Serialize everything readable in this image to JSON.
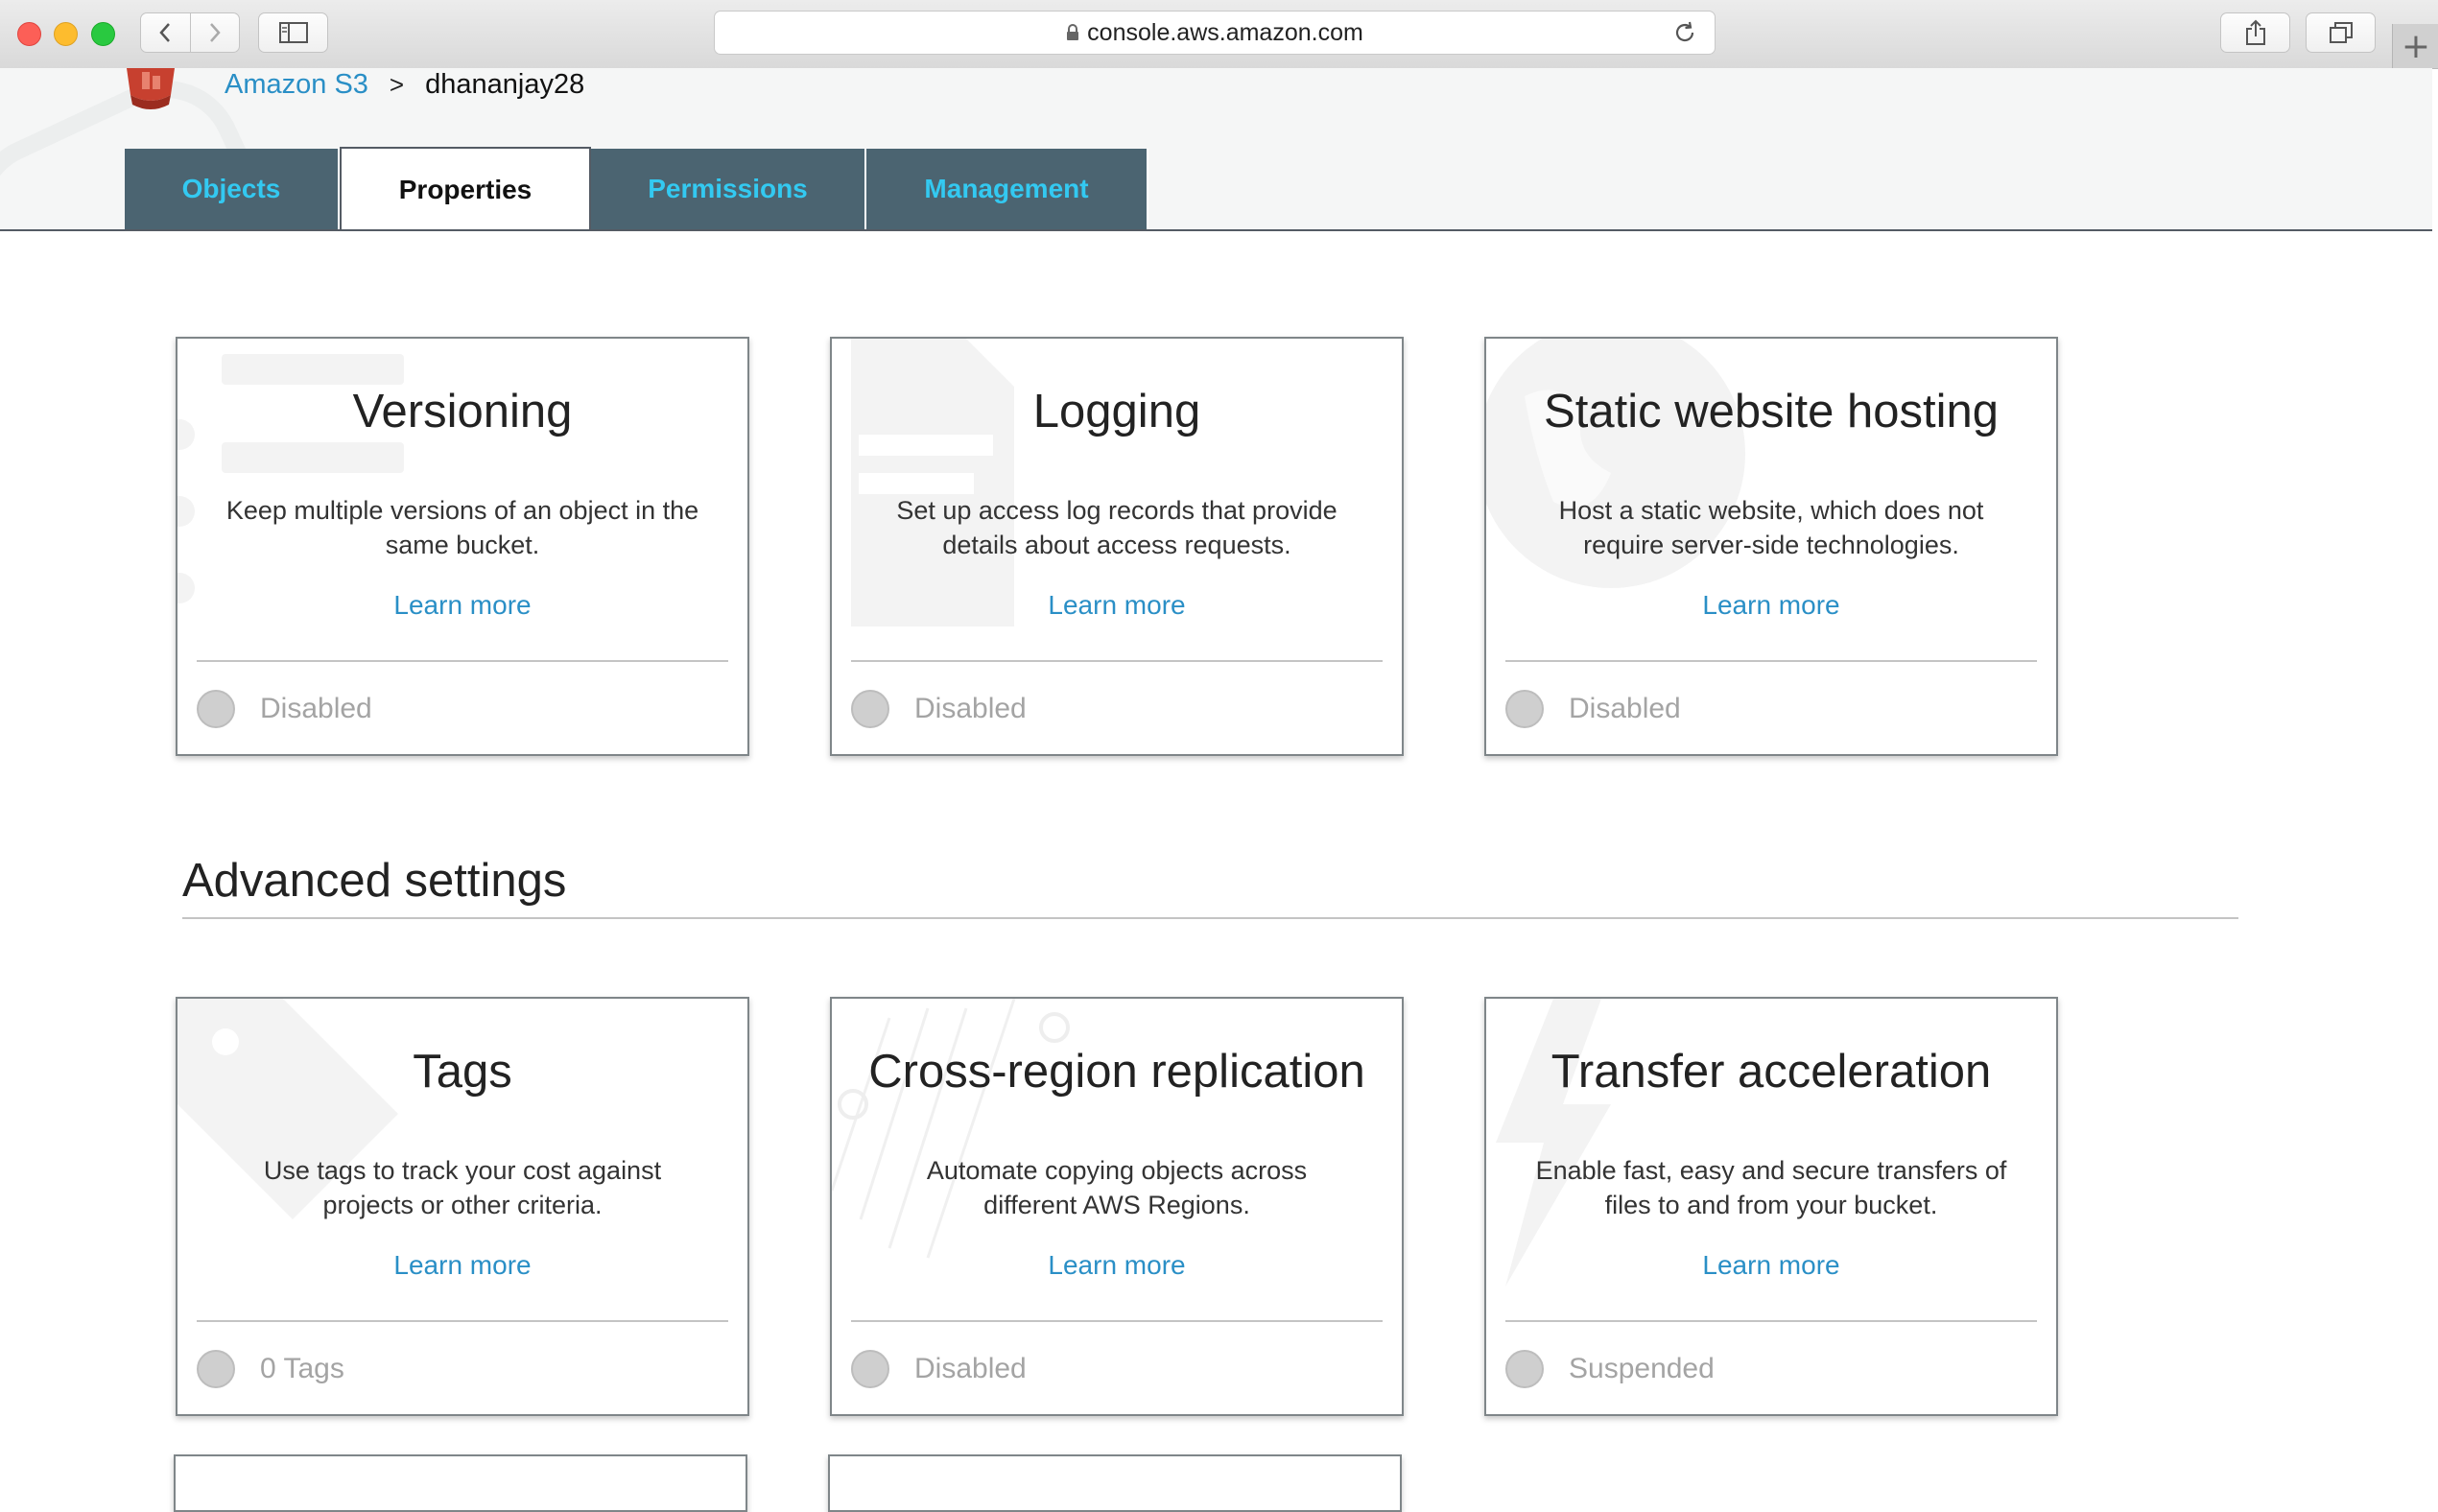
{
  "browser": {
    "url": "console.aws.amazon.com",
    "new_tab_label": "+"
  },
  "breadcrumb": {
    "service": "Amazon S3",
    "separator": ">",
    "bucket": "dhananjay28"
  },
  "tabs": [
    {
      "label": "Objects",
      "active": false
    },
    {
      "label": "Properties",
      "active": true
    },
    {
      "label": "Permissions",
      "active": false
    },
    {
      "label": "Management",
      "active": false
    }
  ],
  "properties_cards": [
    {
      "title": "Versioning",
      "description": "Keep multiple versions of an object in the same bucket.",
      "link": "Learn more",
      "status": "Disabled"
    },
    {
      "title": "Logging",
      "description": "Set up access log records that provide details about access requests.",
      "link": "Learn more",
      "status": "Disabled"
    },
    {
      "title": "Static website hosting",
      "description": "Host a static website, which does not require server-side technologies.",
      "link": "Learn more",
      "status": "Disabled"
    }
  ],
  "advanced": {
    "title": "Advanced settings",
    "cards": [
      {
        "title": "Tags",
        "description": "Use tags to track your cost against projects or other criteria.",
        "link": "Learn more",
        "status": "0 Tags"
      },
      {
        "title": "Cross-region replication",
        "description": "Automate copying objects across different AWS Regions.",
        "link": "Learn more",
        "status": "Disabled"
      },
      {
        "title": "Transfer acceleration",
        "description": "Enable fast, easy and secure transfers of files to and from your bucket.",
        "link": "Learn more",
        "status": "Suspended"
      }
    ]
  },
  "colors": {
    "tab_bg": "#4b6471",
    "tab_text": "#33c9f1",
    "link": "#2a8fc6",
    "status_text": "#a4a4a4"
  }
}
